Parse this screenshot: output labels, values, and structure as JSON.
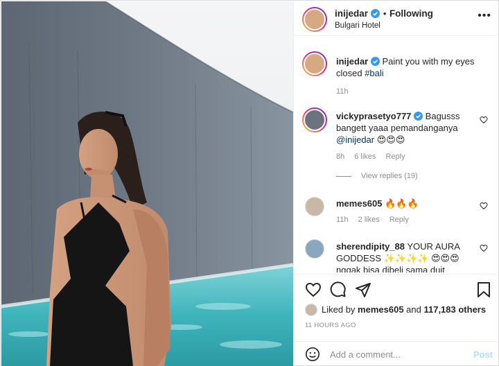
{
  "post": {
    "author": "inijedar",
    "following_label": "Following",
    "dot": "•",
    "location": "Bulgari Hotel",
    "more_icon": "more-dots-icon"
  },
  "caption": {
    "username": "inijedar",
    "text": "Paint you with my eyes closed",
    "hashtag": "#bali",
    "time": "11h"
  },
  "comments": [
    {
      "username": "vickyprasetyo777",
      "text": "Bagusss bangett yaaa pemandanganya",
      "mention": "@inijedar",
      "emoji": "😍😍😍",
      "time": "8h",
      "likes": "6 likes",
      "reply": "Reply",
      "view_replies": "View replies (19)"
    },
    {
      "username": "memes605",
      "emoji": "🔥🔥🔥",
      "time": "11h",
      "likes": "2 likes",
      "reply": "Reply"
    },
    {
      "username": "sherendipity_88",
      "text": "YOUR AURA GODDESS ✨✨✨✨ 😍😍😍 nggak bisa dibeli sama duit berapapun.."
    }
  ],
  "actions": {
    "liked_by_prefix": "Liked by ",
    "liked_by_user": "memes605",
    "liked_by_and": " and ",
    "liked_by_count": "117,183 others",
    "time_ago": "11 HOURS AGO"
  },
  "comment_box": {
    "placeholder": "Add a comment...",
    "post_label": "Post"
  },
  "colors": {
    "verified": "#3897f0",
    "link": "#00376b",
    "muted": "#8e8e8e",
    "post_disabled": "#b2dffc"
  }
}
